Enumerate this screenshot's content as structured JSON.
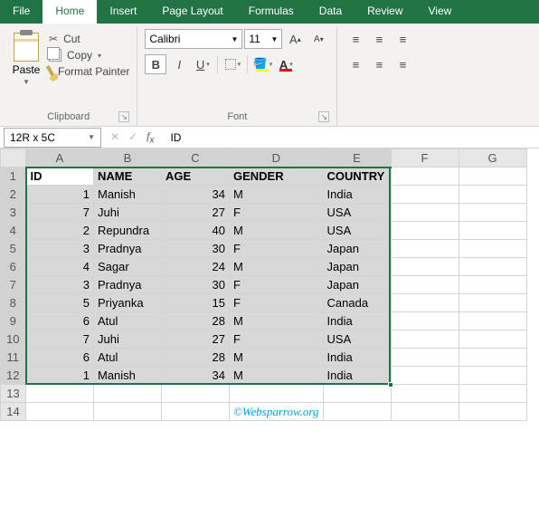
{
  "tabs": [
    "File",
    "Home",
    "Insert",
    "Page Layout",
    "Formulas",
    "Data",
    "Review",
    "View"
  ],
  "active_tab": 1,
  "ribbon": {
    "clipboard": {
      "paste": "Paste",
      "cut": "Cut",
      "copy": "Copy",
      "format_painter": "Format Painter",
      "label": "Clipboard"
    },
    "font": {
      "name": "Calibri",
      "size": "11",
      "label": "Font"
    }
  },
  "namebox": "12R x 5C",
  "formula_value": "ID",
  "columns": [
    "A",
    "B",
    "C",
    "D",
    "E",
    "F",
    "G"
  ],
  "row_numbers": [
    1,
    2,
    3,
    4,
    5,
    6,
    7,
    8,
    9,
    10,
    11,
    12,
    13,
    14
  ],
  "selection": {
    "cols": 5,
    "rows": 12
  },
  "chart_data": {
    "type": "table",
    "headers": [
      "ID",
      "NAME",
      "AGE",
      "GENDER",
      "COUNTRY"
    ],
    "rows": [
      {
        "ID": 1,
        "NAME": "Manish",
        "AGE": 34,
        "GENDER": "M",
        "COUNTRY": "India"
      },
      {
        "ID": 7,
        "NAME": "Juhi",
        "AGE": 27,
        "GENDER": "F",
        "COUNTRY": "USA"
      },
      {
        "ID": 2,
        "NAME": "Repundra",
        "AGE": 40,
        "GENDER": "M",
        "COUNTRY": "USA"
      },
      {
        "ID": 3,
        "NAME": "Pradnya",
        "AGE": 30,
        "GENDER": "F",
        "COUNTRY": "Japan"
      },
      {
        "ID": 4,
        "NAME": "Sagar",
        "AGE": 24,
        "GENDER": "M",
        "COUNTRY": "Japan"
      },
      {
        "ID": 3,
        "NAME": "Pradnya",
        "AGE": 30,
        "GENDER": "F",
        "COUNTRY": "Japan"
      },
      {
        "ID": 5,
        "NAME": "Priyanka",
        "AGE": 15,
        "GENDER": "F",
        "COUNTRY": "Canada"
      },
      {
        "ID": 6,
        "NAME": "Atul",
        "AGE": 28,
        "GENDER": "M",
        "COUNTRY": "India"
      },
      {
        "ID": 7,
        "NAME": "Juhi",
        "AGE": 27,
        "GENDER": "F",
        "COUNTRY": "USA"
      },
      {
        "ID": 6,
        "NAME": "Atul",
        "AGE": 28,
        "GENDER": "M",
        "COUNTRY": "India"
      },
      {
        "ID": 1,
        "NAME": "Manish",
        "AGE": 34,
        "GENDER": "M",
        "COUNTRY": "India"
      }
    ]
  },
  "watermark": "©Websparrow.org"
}
